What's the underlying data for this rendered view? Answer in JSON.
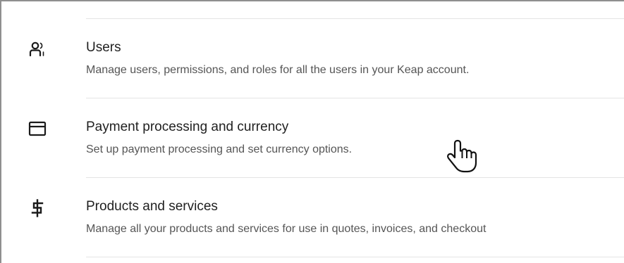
{
  "settings_list": {
    "items": [
      {
        "icon": "users-icon",
        "title": "Users",
        "description": "Manage users, permissions, and roles for all the users in your Keap account."
      },
      {
        "icon": "card-icon",
        "title": "Payment processing and currency",
        "description": "Set up payment processing and set currency options."
      },
      {
        "icon": "dollar-icon",
        "title": "Products and services",
        "description": "Manage all your products and services for use in quotes, invoices, and checkout"
      }
    ]
  },
  "colors": {
    "title_text": "#1f1f1f",
    "description_text": "#555555",
    "divider": "#e4e4e4"
  }
}
